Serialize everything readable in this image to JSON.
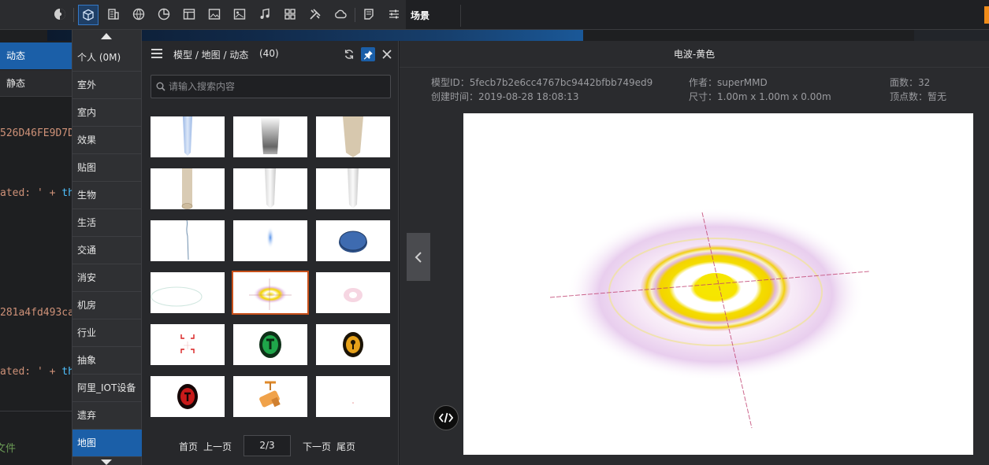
{
  "toolbar": {
    "icons": [
      "palette-icon",
      "cube-icon",
      "building-icon",
      "globe-icon",
      "pie-chart-icon",
      "layout-icon",
      "image-icon",
      "picture-icon",
      "music-icon",
      "component-icon",
      "tools-icon",
      "cloud-icon",
      "note-icon",
      "sliders-icon"
    ],
    "active_icon": "cube-icon"
  },
  "scene": {
    "tab_label": "场景"
  },
  "left": {
    "tabs": [
      {
        "label": "动态",
        "active": true
      },
      {
        "label": "静态",
        "active": false
      }
    ],
    "code_lines": [
      {
        "text": "526D46FE9D7D",
        "color": "orange"
      },
      {
        "prefix": "ated: ' + ",
        "suffix": "th"
      },
      {
        "text": "281a4fd493ca",
        "color": "orange"
      },
      {
        "prefix": "ated: ' + ",
        "suffix": "th"
      },
      {
        "text": "文件",
        "color": "green"
      }
    ]
  },
  "categories": {
    "items": [
      "个人 (0M)",
      "室外",
      "室内",
      "效果",
      "贴图",
      "生物",
      "生活",
      "交通",
      "消安",
      "机房",
      "行业",
      "抽象",
      "阿里_IOT设备",
      "遗弃",
      "地图"
    ],
    "active_index": 14
  },
  "library": {
    "breadcrumb": "模型 / 地图 / 动态",
    "count": "(40)",
    "search_placeholder": "请输入搜索内容",
    "selected_tile": 10,
    "pager": {
      "first": "首页",
      "prev": "上一页",
      "page": "2/3",
      "next": "下一页",
      "last": "尾页"
    }
  },
  "preview": {
    "title": "电波-黄色",
    "model_id": "模型ID：5fecb7b2e6cc4767bc9442bfbb749ed9",
    "created": "创建时间：2019-08-28 18:08:13",
    "author": "作者：superMMD",
    "size": "尺寸：1.00m x 1.00m x 0.00m",
    "faces": "面数：32",
    "vertices": "顶点数：暂无"
  },
  "colors": {
    "accent": "#1b5fa8",
    "selection": "#c8501a",
    "wave_yellow": "#f5e000",
    "wave_purple": "#c060c0"
  }
}
